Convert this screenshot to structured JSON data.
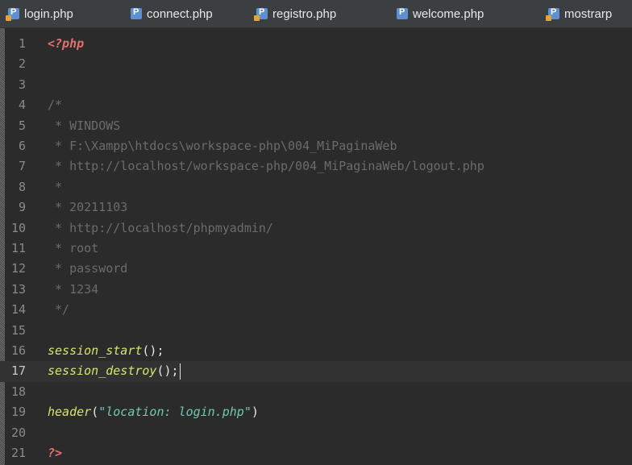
{
  "tabs": [
    {
      "label": "login.php",
      "icon": "php-file-icon-lock",
      "active": true
    },
    {
      "label": "connect.php",
      "icon": "php-file-icon",
      "active": false
    },
    {
      "label": "registro.php",
      "icon": "php-file-icon-lock",
      "active": false
    },
    {
      "label": "welcome.php",
      "icon": "php-file-icon",
      "active": false
    },
    {
      "label": "mostrarp",
      "icon": "php-file-icon-lock",
      "active": false
    }
  ],
  "editor": {
    "current_line": 17,
    "lines": [
      {
        "n": "1",
        "segs": [
          {
            "t": "<?php",
            "c": "kw"
          }
        ]
      },
      {
        "n": "2",
        "segs": []
      },
      {
        "n": "3",
        "segs": []
      },
      {
        "n": "4",
        "segs": [
          {
            "t": "/*",
            "c": "cm"
          }
        ]
      },
      {
        "n": "5",
        "segs": [
          {
            "t": " * WINDOWS",
            "c": "cm"
          }
        ]
      },
      {
        "n": "6",
        "segs": [
          {
            "t": " * F:\\Xampp\\htdocs\\workspace-php\\004_MiPaginaWeb",
            "c": "cm"
          }
        ]
      },
      {
        "n": "7",
        "segs": [
          {
            "t": " * http://localhost/workspace-php/004_MiPaginaWeb/logout.php",
            "c": "cm"
          }
        ]
      },
      {
        "n": "8",
        "segs": [
          {
            "t": " *",
            "c": "cm"
          }
        ]
      },
      {
        "n": "9",
        "segs": [
          {
            "t": " * 20211103",
            "c": "cm"
          }
        ]
      },
      {
        "n": "10",
        "segs": [
          {
            "t": " * http://localhost/phpmyadmin/",
            "c": "cm"
          }
        ]
      },
      {
        "n": "11",
        "segs": [
          {
            "t": " * root",
            "c": "cm"
          }
        ]
      },
      {
        "n": "12",
        "segs": [
          {
            "t": " * password",
            "c": "cm"
          }
        ]
      },
      {
        "n": "13",
        "segs": [
          {
            "t": " * 1234",
            "c": "cm"
          }
        ]
      },
      {
        "n": "14",
        "segs": [
          {
            "t": " */",
            "c": "cm"
          }
        ]
      },
      {
        "n": "15",
        "segs": []
      },
      {
        "n": "16",
        "segs": [
          {
            "t": "session_start",
            "c": "fn"
          },
          {
            "t": "();",
            "c": "pn"
          }
        ]
      },
      {
        "n": "17",
        "segs": [
          {
            "t": "session_destroy",
            "c": "fn"
          },
          {
            "t": "();",
            "c": "pn"
          }
        ]
      },
      {
        "n": "18",
        "segs": []
      },
      {
        "n": "19",
        "segs": [
          {
            "t": "header",
            "c": "fn"
          },
          {
            "t": "(",
            "c": "pn"
          },
          {
            "t": "\"location: login.php\"",
            "c": "st"
          },
          {
            "t": ")",
            "c": "pn"
          }
        ]
      },
      {
        "n": "20",
        "segs": []
      },
      {
        "n": "21",
        "segs": [
          {
            "t": "?>",
            "c": "kw"
          }
        ]
      }
    ]
  },
  "colors": {
    "background": "#2b2b2b",
    "tabbar": "#3c3f41",
    "keyword": "#e07070",
    "function": "#d9e36a",
    "string": "#6ec9b3",
    "comment": "#6b6b6b"
  }
}
